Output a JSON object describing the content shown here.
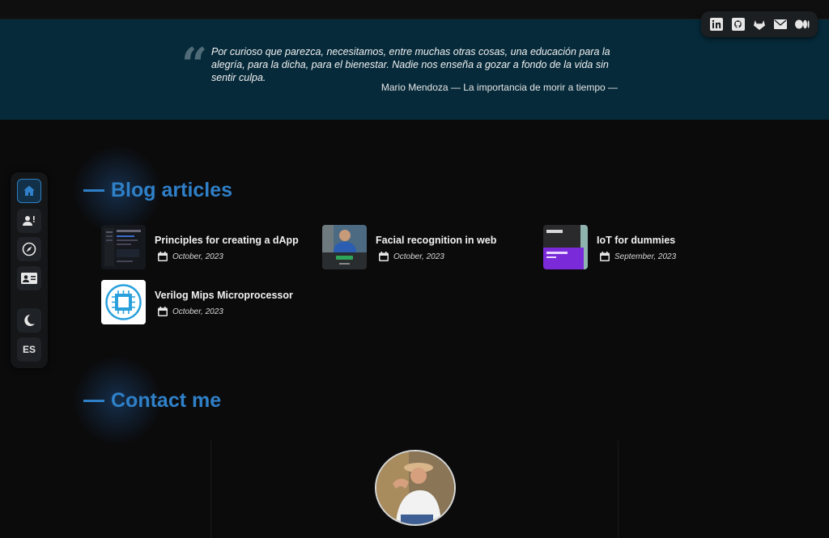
{
  "quote": {
    "text": "Por curioso que parezca, necesitamos, entre muchas otras cosas, una educación para la alegría, para la dicha, para el bienestar. Nadie nos enseña a gozar a fondo de la vida sin sentir culpa.",
    "author": "Mario Mendoza — La importancia de morir a tiempo —"
  },
  "social": [
    "linkedin-icon",
    "github-icon",
    "gitlab-icon",
    "mail-icon",
    "medium-icon"
  ],
  "sidebar": {
    "items": [
      "home-icon",
      "about-icon",
      "explore-icon",
      "contact-card-icon"
    ],
    "theme_icon": "moon-icon",
    "language": "ES"
  },
  "blog": {
    "title": "Blog articles",
    "articles": [
      {
        "title": "Principles for creating a dApp",
        "date": "October, 2023"
      },
      {
        "title": "Facial recognition in web",
        "date": "October, 2023"
      },
      {
        "title": "IoT for dummies",
        "date": "September, 2023"
      },
      {
        "title": "Verilog Mips Microprocessor",
        "date": "October, 2023"
      }
    ]
  },
  "contact": {
    "title": "Contact me"
  },
  "colors": {
    "accent": "#2f80c8",
    "quote_bg": "#062a3a",
    "page_bg": "#0b0b0c"
  }
}
